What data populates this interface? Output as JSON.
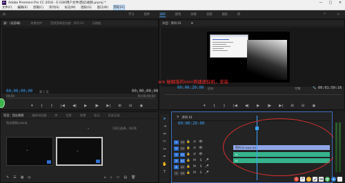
{
  "window": {
    "app_icon": "Pr",
    "title": "Adobe Premiere Pro CC 2018 - E:\\180用户文件\\西瓜\\视频.prproj *",
    "controls": [
      "—",
      "□",
      "✕"
    ]
  },
  "menu": {
    "items": [
      "文件(F)",
      "编辑(E)",
      "剪辑(C)",
      "序列(S)",
      "标记(M)",
      "图形(G)",
      "窗口(W)",
      "帮助(H)"
    ],
    "active_index": 7
  },
  "workspace": {
    "tabs": [
      "学习",
      "组件",
      "编辑",
      "颜色",
      "效果",
      "音频",
      "图形",
      "库"
    ],
    "active_index": 2,
    "more": "»",
    "home_icon": "home-icon",
    "search_icon": "search-icon"
  },
  "source_panel": {
    "tabs": [
      "源：（无剪辑）",
      "效果控件",
      "音频剪辑混合器：序列 01",
      "元数据"
    ],
    "menu_icon": "≡",
    "timecode_in": "00;00;00;00",
    "timecode_out": "00;00;00;00",
    "page_label": "第 1 页",
    "ruler_start": "00;00",
    "ruler_end": "00;00;00;00"
  },
  "program_panel": {
    "tabs": [
      "节目：序列 01"
    ],
    "menu_icon": "≡",
    "timecode": "00:00:20:00",
    "fit_label": "适合",
    "quality_label": "完整",
    "duration": "00:01:50:16",
    "ruler_start": "00:00",
    "ruler_mid": "00:00:20:00",
    "ruler_end": "00:01:20:00"
  },
  "overlay_caption": "are 破解版的sion例建虚拟机，安装",
  "transport_icons": [
    "marker-icon",
    "in-point-icon",
    "out-point-icon",
    "step-back-icon",
    "play-icon",
    "step-forward-icon",
    "insert-icon",
    "overwrite-icon",
    "export-frame-icon"
  ],
  "transport_glyphs": [
    "▾",
    "{",
    "}",
    "|◀",
    "◀|",
    "▶",
    "|▶",
    "▶|",
    "⊞",
    "⊟",
    "◉"
  ],
  "project_panel": {
    "tabs": [
      "项目：西瓜视频",
      "媒体浏览器",
      "库",
      "信息",
      "效果",
      "标记",
      "历史记录"
    ],
    "menu_icon": "»",
    "file": "西瓜视频.prproj",
    "search_placeholder": "",
    "selection_info": "1项已选择，共2项",
    "items_count": 2
  },
  "timeline": {
    "header_close": "✕",
    "sequence_tab": "序列 01",
    "timecode": "00:00:20:00",
    "tracks": [
      {
        "name": "V3",
        "type": "video"
      },
      {
        "name": "V2",
        "type": "video"
      },
      {
        "name": "V1",
        "type": "video"
      },
      {
        "name": "A1",
        "type": "audio"
      },
      {
        "name": "A2",
        "type": "audio"
      },
      {
        "name": "A3",
        "type": "audio"
      }
    ],
    "video_clip": "序列 01.mp4 [V]",
    "audio_clip_a1": "fx",
    "audio_clip_a2": "fx"
  },
  "meter": {
    "labels": [
      "S",
      "S"
    ]
  },
  "tray": {
    "items": [
      "S",
      "中",
      "·",
      "🎤",
      "⌨",
      "👕",
      "⊞",
      "⋯"
    ]
  }
}
